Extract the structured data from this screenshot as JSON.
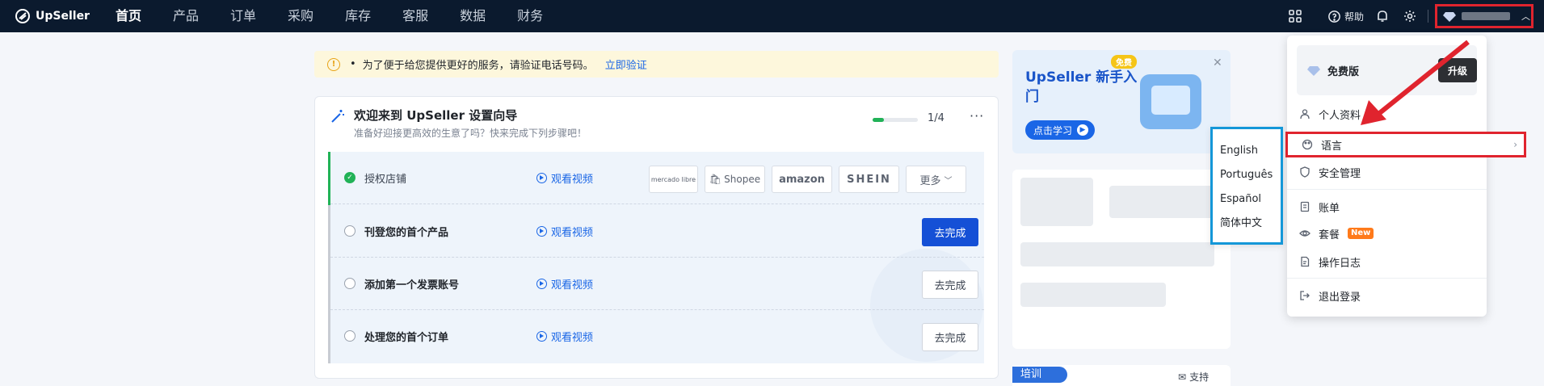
{
  "app": {
    "logo_text": "UpSeller"
  },
  "nav": {
    "items": [
      {
        "label": "首页",
        "active": true
      },
      {
        "label": "产品"
      },
      {
        "label": "订单"
      },
      {
        "label": "采购"
      },
      {
        "label": "库存"
      },
      {
        "label": "客服"
      },
      {
        "label": "数据"
      },
      {
        "label": "财务"
      }
    ],
    "help_label": "帮助"
  },
  "notice": {
    "text": "为了便于给您提供更好的服务，请验证电话号码。",
    "link": "立即验证"
  },
  "wizard": {
    "title": "欢迎来到 UpSeller 设置向导",
    "subtitle": "准备好迎接更高效的生意了吗？快来完成下列步骤吧！",
    "progress": 0.25,
    "count": "1/4",
    "video_label": "观看视频",
    "steps": [
      {
        "label": "授权店铺",
        "done": true
      },
      {
        "label": "刊登您的首个产品",
        "done": false,
        "button": "去完成",
        "primary": true
      },
      {
        "label": "添加第一个发票账号",
        "done": false,
        "button": "去完成"
      },
      {
        "label": "处理您的首个订单",
        "done": false,
        "button": "去完成"
      }
    ],
    "platforms": [
      "mercado libre",
      "Shopee",
      "amazon",
      "SHEIN"
    ],
    "more_label": "更多"
  },
  "promo": {
    "badge": "免费",
    "title": "UpSeller 新手入门",
    "button": "点击学习"
  },
  "training": {
    "tag": "培训",
    "support": "支持"
  },
  "language_menu": {
    "options": [
      "English",
      "Português",
      "Español",
      "简体中文"
    ]
  },
  "user_menu": {
    "plan": "免费版",
    "upgrade": "升级",
    "items": {
      "profile": "个人资料",
      "language": "语言",
      "security": "安全管理",
      "billing": "账单",
      "package": "套餐",
      "package_badge": "New",
      "logs": "操作日志",
      "logout": "退出登录"
    }
  },
  "colors": {
    "nav_bg": "#0b1a2e",
    "primary": "#1550d6",
    "success": "#21b257",
    "highlight_red": "#e0242e",
    "highlight_blue": "#1497d8",
    "badge_orange": "#ff7a1a"
  }
}
